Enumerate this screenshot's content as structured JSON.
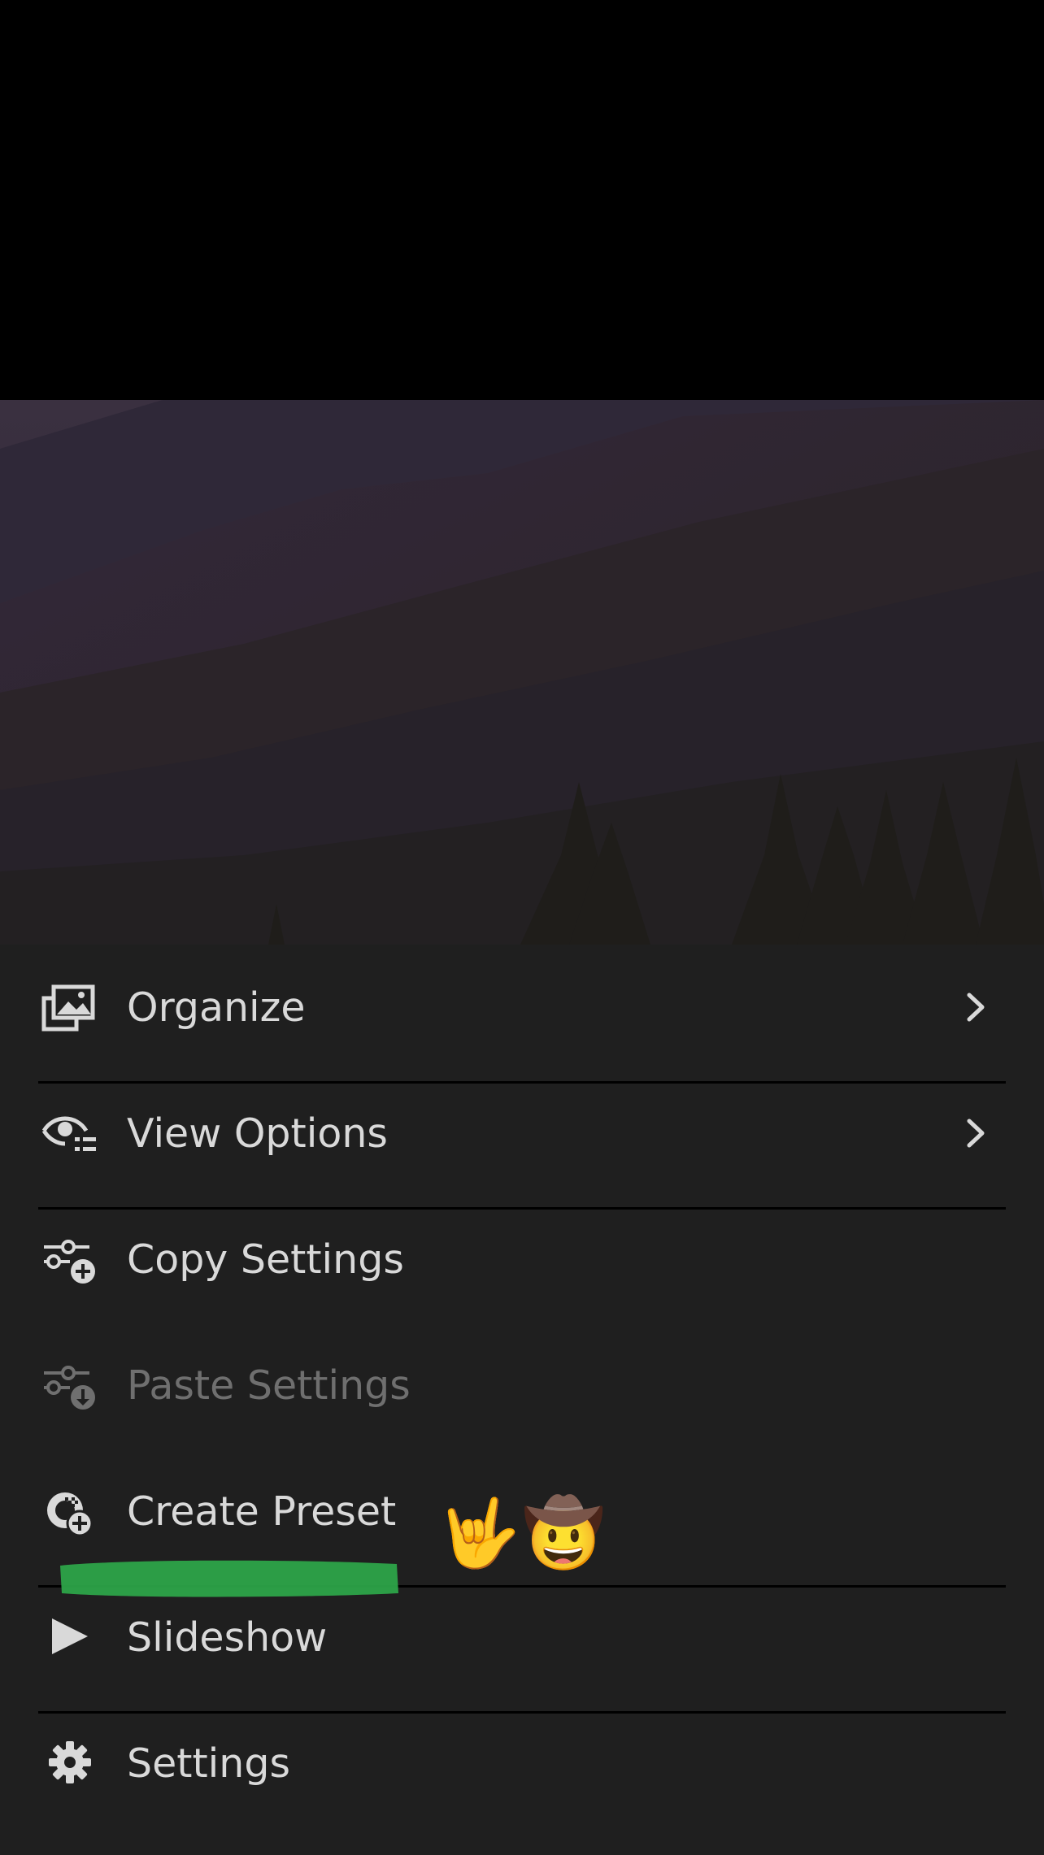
{
  "photo": {
    "icon": "mountain-forest-photo"
  },
  "menu": {
    "items": [
      {
        "label": "Organize",
        "icon": "organize-icon",
        "has_chevron": true,
        "enabled": true
      },
      {
        "label": "View Options",
        "icon": "view-options-icon",
        "has_chevron": true,
        "enabled": true
      },
      {
        "label": "Copy Settings",
        "icon": "copy-settings-icon",
        "has_chevron": false,
        "enabled": true
      },
      {
        "label": "Paste Settings",
        "icon": "paste-settings-icon",
        "has_chevron": false,
        "enabled": false
      },
      {
        "label": "Create Preset",
        "icon": "create-preset-icon",
        "has_chevron": false,
        "enabled": true
      },
      {
        "label": "Slideshow",
        "icon": "play-icon",
        "has_chevron": false,
        "enabled": true
      },
      {
        "label": "Settings",
        "icon": "gear-icon",
        "has_chevron": false,
        "enabled": true
      }
    ]
  },
  "annotations": {
    "emoji_1": "🤟",
    "emoji_2": "🤠",
    "highlight_color": "#2ea84a"
  },
  "colors": {
    "menu_background": "#1f1f1f",
    "text": "#d9d9d9",
    "text_disabled": "#6f6f6f",
    "divider": "#000000"
  }
}
